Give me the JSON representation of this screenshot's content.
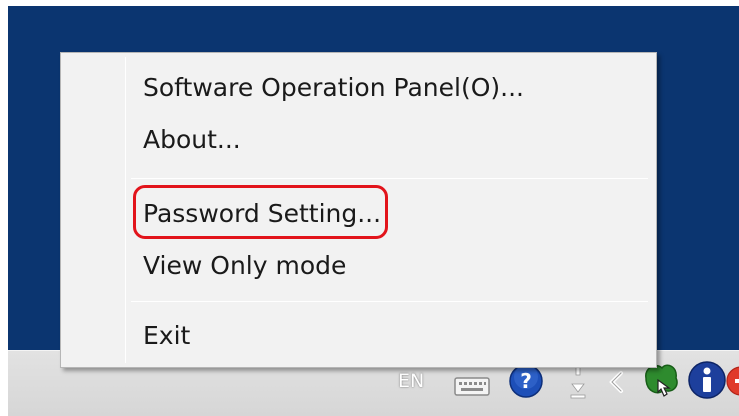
{
  "context_menu": {
    "items": [
      {
        "label": "Software Operation Panel(O)..."
      },
      {
        "label": "About..."
      },
      {
        "label": "Password Setting..."
      },
      {
        "label": "View Only mode"
      },
      {
        "label": "Exit"
      }
    ],
    "highlighted_item": "Password Setting...",
    "highlight_color": "#e2141b"
  },
  "taskbar": {
    "language": "EN",
    "tray_icons": [
      "keyboard-icon",
      "help-icon",
      "updown-icon",
      "chevron-left-icon",
      "scanner-icon",
      "info-icon",
      "alert-icon"
    ]
  },
  "colors": {
    "desktop": "#0b3570",
    "menu_background": "#f2f2f2",
    "taskbar": "#d6d6d6"
  }
}
